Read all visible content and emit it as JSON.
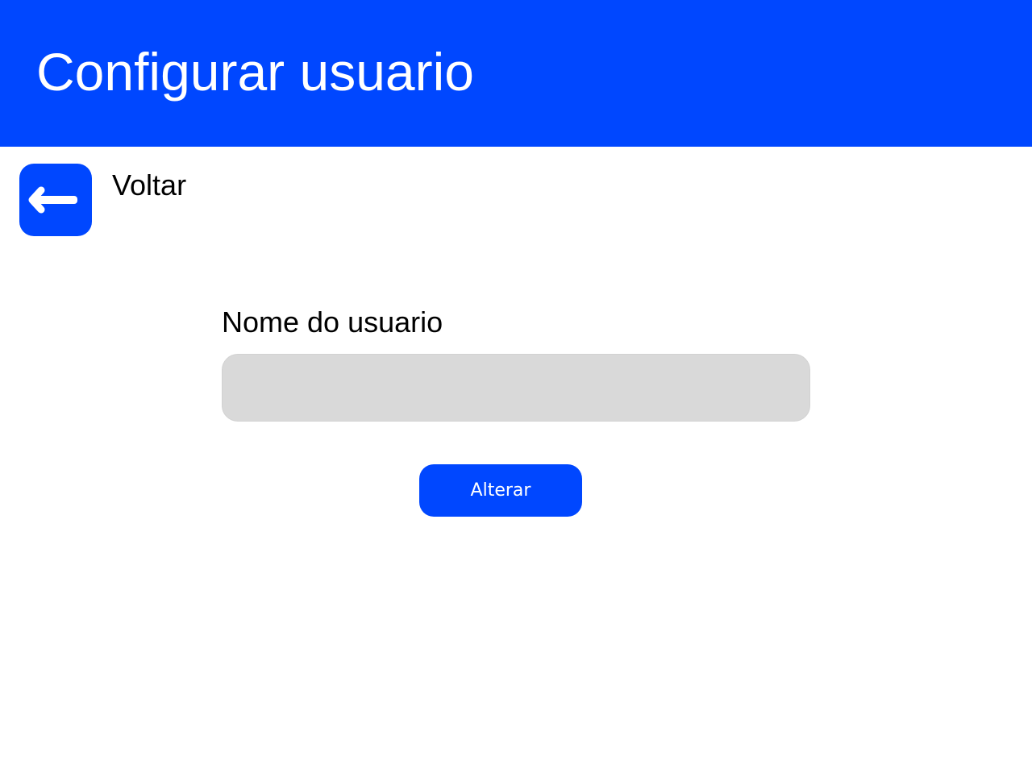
{
  "colors": {
    "accent": "#0047ff",
    "input_background": "#d9d9d9",
    "text": "#000000",
    "header_text": "#ffffff"
  },
  "header": {
    "title": "Configurar usuario"
  },
  "back": {
    "icon": "arrow-left-icon",
    "label": "Voltar"
  },
  "form": {
    "name_label": "Nome do usuario",
    "name_value": "",
    "name_placeholder": "",
    "submit_label": "Alterar"
  }
}
